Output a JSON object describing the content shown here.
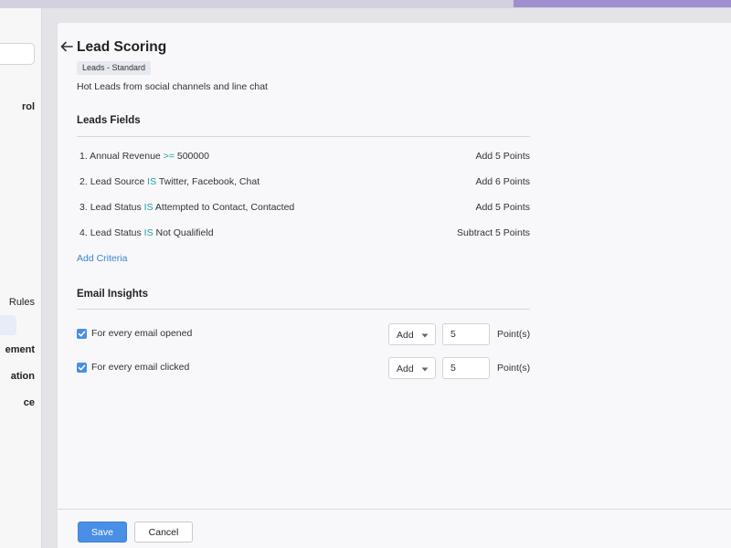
{
  "colors": {
    "accent": "#4a8fe6",
    "operator": "#1fa1a1",
    "link": "#3a84d6",
    "top_accent": "#a08fd0"
  },
  "sidebar": {
    "items": [
      {
        "label": "rol"
      },
      {
        "label": "Rules"
      },
      {
        "label": "ement"
      },
      {
        "label": "ation"
      },
      {
        "label": "ce"
      }
    ]
  },
  "header": {
    "back_icon": "arrow-left-icon",
    "title": "Lead Scoring",
    "badge": "Leads - Standard",
    "description": "Hot Leads from social channels and line chat"
  },
  "leads_fields": {
    "title": "Leads Fields",
    "rows": [
      {
        "num": "1.",
        "field": "Annual Revenue",
        "op": ">=",
        "value": "500000",
        "points": "Add 5 Points"
      },
      {
        "num": "2.",
        "field": "Lead Source",
        "op": "IS",
        "value": "Twitter, Facebook, Chat",
        "points": "Add 6 Points"
      },
      {
        "num": "3.",
        "field": "Lead Status",
        "op": "IS",
        "value": "Attempted to Contact, Contacted",
        "points": "Add 5 Points"
      },
      {
        "num": "4.",
        "field": "Lead Status",
        "op": "IS",
        "value": "Not Qualifield",
        "points": "Subtract 5 Points"
      }
    ],
    "add_criteria": "Add Criteria"
  },
  "email_insights": {
    "title": "Email Insights",
    "rows": [
      {
        "label": "For every email opened",
        "checked": true,
        "action": "Add",
        "value": "5",
        "unit": "Point(s)"
      },
      {
        "label": "For every email clicked",
        "checked": true,
        "action": "Add",
        "value": "5",
        "unit": "Point(s)"
      }
    ]
  },
  "footer": {
    "save": "Save",
    "cancel": "Cancel"
  }
}
